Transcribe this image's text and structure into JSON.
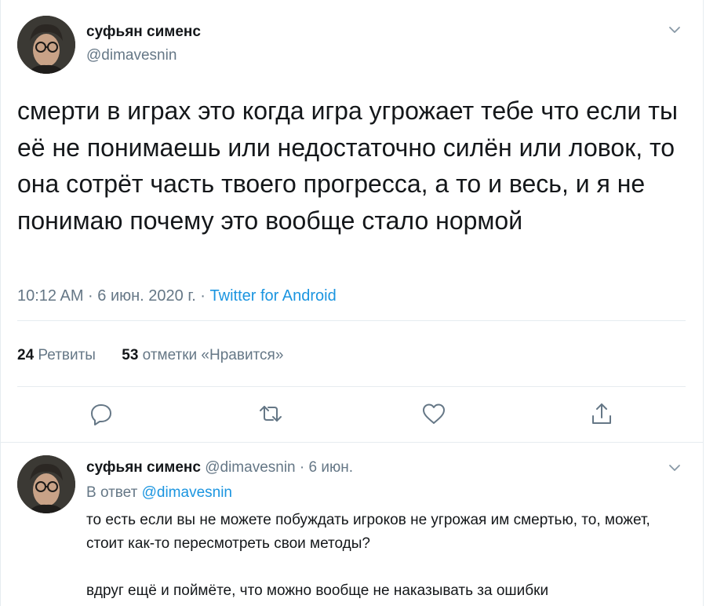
{
  "tweet": {
    "author_name": "суфьян сименс",
    "author_handle": "@dimavesnin",
    "text": "смерти в играх это когда игра угрожает тебе что если ты её не понимаешь или недостаточно силён или ловок, то она сотрёт часть твоего прогресса, а то и весь, и я не понимаю почему это вообще стало нормой",
    "timestamp": "10:12 AM · 6 июн. 2020 г. · ",
    "source": "Twitter for Android",
    "retweets_count": "24",
    "retweets_label": "Ретвиты",
    "likes_count": "53",
    "likes_label": "отметки «Нравится»",
    "actions": [
      {
        "icon": "reply-icon"
      },
      {
        "icon": "retweet-icon"
      },
      {
        "icon": "like-icon"
      },
      {
        "icon": "share-icon"
      }
    ]
  },
  "reply": {
    "author_name": "суфьян сименс",
    "author_handle_and_date": " @dimavesnin · 6 июн.",
    "in_reply_prefix": "В ответ ",
    "in_reply_mention": "@dimavesnin",
    "paragraph1": "то есть если вы не можете побуждать игроков не угрожая им смертью, то, может, стоит как-то пересмотреть свои методы?",
    "paragraph2": "вдруг ещё и поймёте, что можно вообще не наказывать за ошибки"
  },
  "colors": {
    "text": "#14171a",
    "secondary": "#657786",
    "link": "#1b95e0",
    "divider": "#e6ecf0"
  }
}
